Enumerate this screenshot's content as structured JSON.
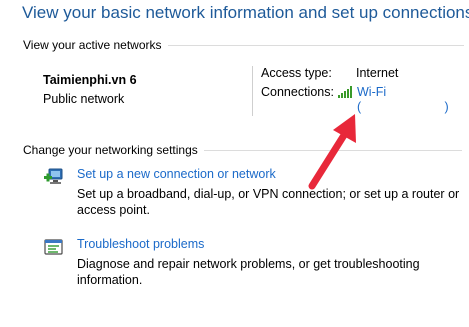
{
  "header": {
    "title": "View your basic network information and set up connections"
  },
  "active_networks": {
    "section_label": "View your active networks",
    "network_name": "Taimienphi.vn  6",
    "network_type": "Public network",
    "access_type_label": "Access type:",
    "access_type_value": "Internet",
    "connections_label": "Connections:",
    "connection_name": "Wi-Fi",
    "connection_detail": "(                        )"
  },
  "networking_settings": {
    "section_label": "Change your networking settings",
    "tasks": [
      {
        "link": "Set up a new connection or network",
        "description": "Set up a broadband, dial-up, or VPN connection; or set up a router or access point.",
        "icon": "network-setup-icon"
      },
      {
        "link": "Troubleshoot problems",
        "description": "Diagnose and repair network problems, or get troubleshooting information.",
        "icon": "troubleshoot-icon"
      }
    ]
  },
  "annotation": {
    "arrow_color": "#e8283a"
  },
  "colors": {
    "title": "#1e5a99",
    "link": "#1b6ac9",
    "signal": "#3a9a2a"
  }
}
